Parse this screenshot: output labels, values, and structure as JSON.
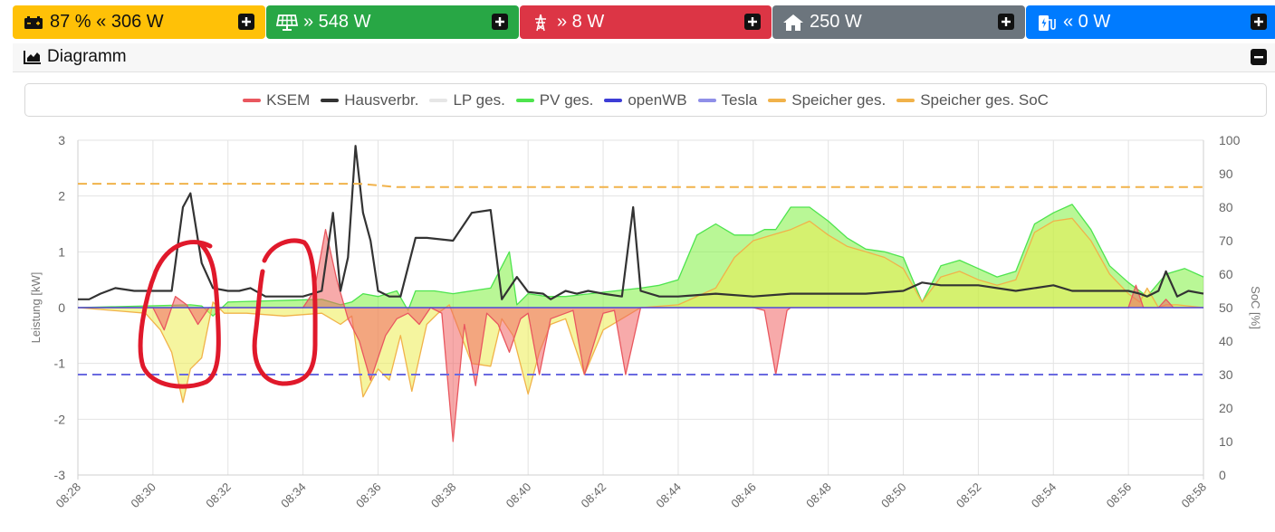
{
  "status_tiles": [
    {
      "id": "battery",
      "icon": "battery-icon",
      "text": "87 % « 306 W",
      "color": "#ffc107",
      "text_color": "#111111"
    },
    {
      "id": "pv",
      "icon": "solar-panel-icon",
      "text": "» 548 W",
      "color": "#28a745",
      "text_color": "#ffffff"
    },
    {
      "id": "grid",
      "icon": "power-tower-icon",
      "text": "» 8 W",
      "color": "#dc3545",
      "text_color": "#ffffff"
    },
    {
      "id": "house",
      "icon": "house-icon",
      "text": "250 W",
      "color": "#6c757d",
      "text_color": "#ffffff"
    },
    {
      "id": "charger",
      "icon": "charging-station-icon",
      "text": "« 0 W",
      "color": "#007bff",
      "text_color": "#ffffff"
    }
  ],
  "diagram": {
    "title": "Diagramm"
  },
  "chart_data": {
    "type": "area",
    "legend_position": "top",
    "grid": true,
    "ylabel": "Leistung [kW]",
    "y2label": "SoC [%]",
    "ylim": [
      -3,
      3
    ],
    "y2lim": [
      0,
      100
    ],
    "yticks": [
      "3",
      "2",
      "1",
      "0",
      "-1",
      "-2",
      "-3"
    ],
    "y2ticks": [
      "100",
      "90",
      "80",
      "70",
      "60",
      "50",
      "40",
      "30",
      "20",
      "10",
      "0"
    ],
    "xlim": [
      0,
      30
    ],
    "xticks": [
      "08:28",
      "08:30",
      "08:32",
      "08:34",
      "08:36",
      "08:38",
      "08:40",
      "08:42",
      "08:44",
      "08:46",
      "08:48",
      "08:50",
      "08:52",
      "08:54",
      "08:56",
      "08:58"
    ],
    "legend": [
      {
        "name": "KSEM",
        "color": "#e9575f"
      },
      {
        "name": "Hausverbr.",
        "color": "#333333"
      },
      {
        "name": "LP ges.",
        "color": "#e6e6e6"
      },
      {
        "name": "PV ges.",
        "color": "#4ee44e"
      },
      {
        "name": "openWB",
        "color": "#3d3dd6"
      },
      {
        "name": "Tesla",
        "color": "#8f8fe8"
      },
      {
        "name": "Speicher ges.",
        "color": "#f1b24a"
      },
      {
        "name": "Speicher ges. SoC",
        "color": "#f1b24a"
      }
    ],
    "series": [
      {
        "name": "PV ges.",
        "axis": "left",
        "color": "#4ee44e",
        "fill": "rgba(128,240,64,0.55)",
        "x": [
          0,
          3,
          3.3,
          3.6,
          4,
          6.5,
          7,
          7.3,
          7.6,
          8,
          8.5,
          8.8,
          9,
          9.5,
          10,
          11,
          11.5,
          11.7,
          12,
          12.5,
          13,
          15,
          15.5,
          16,
          16.5,
          17,
          17.5,
          18,
          18.3,
          18.6,
          19,
          19.5,
          20,
          20.5,
          21,
          21.5,
          22,
          22.5,
          23,
          23.5,
          24,
          24.5,
          25,
          25.5,
          26,
          26.5,
          27,
          27.5,
          28,
          28.5,
          29,
          29.5,
          30
        ],
        "y": [
          0,
          0.05,
          0.03,
          -0.15,
          0.1,
          0.15,
          0.05,
          0.1,
          0.25,
          0.2,
          0.3,
          -0.05,
          0.3,
          0.3,
          0.25,
          0.35,
          1,
          0.05,
          0.25,
          0.2,
          0.2,
          0.35,
          0.4,
          0.5,
          1.3,
          1.5,
          1.3,
          1.3,
          1.4,
          1.4,
          1.8,
          1.8,
          1.55,
          1.25,
          1.05,
          1,
          0.9,
          0.1,
          0.75,
          0.85,
          0.7,
          0.55,
          0.65,
          1.5,
          1.7,
          1.85,
          1.4,
          0.75,
          0.45,
          0.2,
          0.6,
          0.7,
          0.55
        ]
      },
      {
        "name": "Speicher ges.",
        "axis": "left",
        "color": "#f1b24a",
        "fill": "rgba(236,236,80,0.55)",
        "x": [
          0,
          1.8,
          2.2,
          2.5,
          2.8,
          3,
          3.3,
          3.6,
          3.9,
          4.5,
          5.5,
          6.5,
          7,
          7.3,
          7.6,
          8,
          8.3,
          8.6,
          8.9,
          9.3,
          9.6,
          9.9,
          10.5,
          11,
          11.3,
          11.6,
          12,
          12.3,
          12.6,
          13,
          13.5,
          14,
          14.5,
          15,
          16,
          17,
          17.5,
          18,
          18.5,
          19,
          19.5,
          20,
          20.5,
          21,
          21.5,
          22,
          22.5,
          23,
          23.5,
          24,
          24.5,
          25,
          25.5,
          26,
          26.5,
          27,
          27.5,
          28,
          28.3,
          28.5,
          28.8,
          29,
          29.3,
          30
        ],
        "y": [
          0,
          -0.1,
          -0.4,
          -0.8,
          -1.7,
          -1.1,
          -0.9,
          0.1,
          -0.1,
          -0.1,
          -0.15,
          -0.1,
          -0.3,
          -0.15,
          -1.6,
          -1.1,
          -1.3,
          -0.5,
          -1.5,
          -0.3,
          -0.1,
          0.05,
          -1,
          -1.05,
          -0.2,
          -0.5,
          -1.55,
          -0.8,
          -0.3,
          -0.2,
          -1.2,
          -0.4,
          -0.2,
          0,
          0.05,
          0.35,
          0.9,
          1.2,
          1.3,
          1.4,
          1.55,
          1.3,
          1.1,
          1,
          0.9,
          0.7,
          0.1,
          0.55,
          0.65,
          0.5,
          0.4,
          0.5,
          1.35,
          1.55,
          1.6,
          1.2,
          0.6,
          0.25,
          0.1,
          0.35,
          0,
          0.05,
          0.05,
          0
        ]
      },
      {
        "name": "KSEM",
        "axis": "left",
        "color": "#e9575f",
        "fill": "rgba(240,100,100,0.55)",
        "x": [
          0,
          2,
          2.3,
          2.6,
          2.9,
          3.2,
          3.5,
          4,
          5,
          6,
          6.3,
          6.6,
          6.9,
          7.2,
          7.5,
          7.8,
          8.2,
          8.5,
          8.8,
          9.1,
          9.4,
          9.7,
          10,
          10.3,
          10.6,
          10.9,
          11.2,
          11.5,
          11.8,
          12,
          12.3,
          12.6,
          13,
          13.2,
          13.5,
          14,
          14.3,
          14.6,
          15,
          16,
          17,
          18,
          18.3,
          18.6,
          18.9,
          19,
          21,
          23,
          26,
          28,
          28.2,
          28.4,
          28.6,
          28.8,
          29,
          29.2,
          29.5,
          30
        ],
        "y": [
          0,
          0,
          -0.4,
          0.2,
          0.05,
          -0.3,
          0,
          0,
          0,
          0,
          0.3,
          1.4,
          0.5,
          -0.2,
          -0.6,
          -1.3,
          -0.5,
          -0.2,
          -0.1,
          -0.3,
          0,
          -0.1,
          -2.4,
          -0.3,
          -1.4,
          -0.1,
          -0.3,
          -0.8,
          -0.2,
          -0.1,
          -1.2,
          -0.2,
          -0.1,
          -0.05,
          -1.2,
          -0.1,
          -0.05,
          -1.2,
          0,
          0,
          0,
          0,
          -0.05,
          -1.2,
          -0.05,
          0,
          0,
          0,
          0,
          0,
          0.4,
          0,
          0,
          0,
          0.15,
          0,
          0,
          0
        ]
      },
      {
        "name": "Hausverbr.",
        "axis": "left",
        "color": "#333333",
        "fill": "none",
        "x": [
          0,
          0.3,
          0.6,
          1,
          1.5,
          2,
          2.5,
          2.8,
          3,
          3.3,
          3.6,
          4,
          4.3,
          4.6,
          5,
          6,
          6.5,
          6.8,
          7,
          7.2,
          7.4,
          7.6,
          7.8,
          8,
          8.3,
          8.6,
          9,
          9.3,
          10,
          10.5,
          11,
          11.3,
          11.7,
          12,
          12.4,
          12.6,
          13,
          13.3,
          13.6,
          14,
          14.5,
          14.8,
          15,
          15.5,
          16,
          17,
          18,
          19,
          20,
          20.5,
          21,
          22,
          22.5,
          23,
          24,
          25,
          26,
          26.5,
          27,
          28,
          28.3,
          28.5,
          28.8,
          29,
          29.3,
          29.6,
          30
        ],
        "y": [
          0.15,
          0.15,
          0.25,
          0.35,
          0.3,
          0.3,
          0.3,
          1.8,
          2.05,
          0.8,
          0.35,
          0.3,
          0.3,
          0.35,
          0.2,
          0.2,
          0.3,
          1.7,
          0.3,
          0.9,
          2.9,
          1.7,
          1.2,
          0.3,
          0.2,
          0.2,
          1.25,
          1.25,
          1.2,
          1.7,
          1.75,
          0.15,
          0.55,
          0.28,
          0.25,
          0.15,
          0.3,
          0.25,
          0.3,
          0.25,
          0.2,
          1.8,
          0.3,
          0.2,
          0.2,
          0.25,
          0.2,
          0.25,
          0.25,
          0.25,
          0.25,
          0.3,
          0.45,
          0.4,
          0.4,
          0.3,
          0.4,
          0.3,
          0.3,
          0.3,
          0.25,
          0.2,
          0.3,
          0.65,
          0.2,
          0.3,
          0.25
        ]
      },
      {
        "name": "Tesla",
        "axis": "left",
        "color": "#8f8fe8",
        "fill": "none",
        "x": [
          0,
          30
        ],
        "y": [
          0,
          0
        ]
      },
      {
        "name": "openWB",
        "axis": "left",
        "color": "#3d3dd6",
        "fill": "none",
        "x": [
          0,
          30
        ],
        "y": [
          0,
          0
        ]
      },
      {
        "name": "Speicher ges. SoC",
        "axis": "right",
        "color": "#f1b24a",
        "fill": "none",
        "dashed": true,
        "x": [
          0,
          7,
          7.5,
          8,
          8.5,
          30
        ],
        "y": [
          87,
          87,
          87,
          86.5,
          86,
          86
        ]
      },
      {
        "name": "Tesla SoC",
        "axis": "right",
        "color": "#6a6ae0",
        "fill": "none",
        "dashed": true,
        "x": [
          0,
          30
        ],
        "y": [
          30,
          30
        ]
      }
    ],
    "annotations": [
      {
        "type": "hand-drawn-circle",
        "color": "#e0192b",
        "x_center": 3.6,
        "y_center": -0.9
      },
      {
        "type": "hand-drawn-circle",
        "color": "#e0192b",
        "x_center": 5.6,
        "y_center": -0.3
      }
    ]
  }
}
